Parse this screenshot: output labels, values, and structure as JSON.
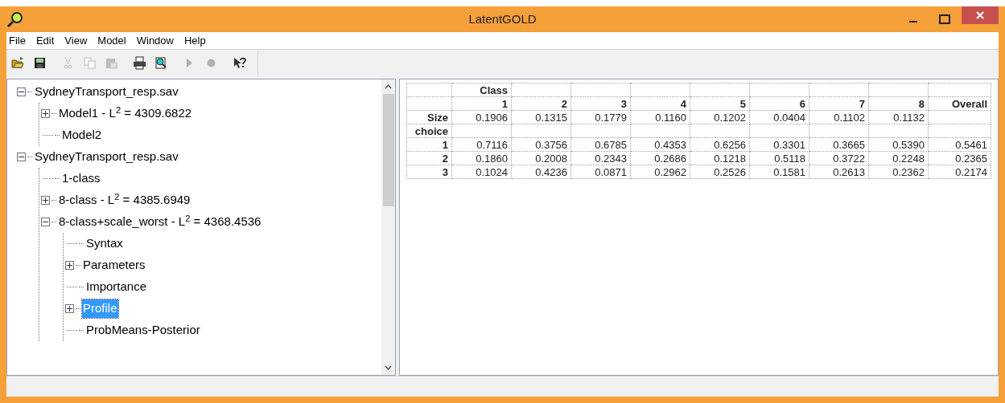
{
  "window": {
    "title": "LatentGOLD"
  },
  "menu": [
    "File",
    "Edit",
    "View",
    "Model",
    "Window",
    "Help"
  ],
  "toolbar": [
    {
      "disabled": false
    },
    {
      "disabled": false
    },
    {
      "disabled": true
    },
    {
      "disabled": true
    },
    {
      "disabled": true
    },
    {
      "disabled": false
    },
    {
      "disabled": false
    },
    {
      "disabled": true
    },
    {
      "disabled": true
    },
    {
      "disabled": false
    }
  ],
  "tree": [
    {
      "label": "SydneyTransport_resp.sav",
      "expanded": true,
      "selected": false,
      "children": [
        {
          "label": "Model1 - L$^{2}$ = 4309.6822",
          "expanded": false,
          "selected": false
        },
        {
          "label": "Model2",
          "selected": false
        }
      ]
    },
    {
      "label": "SydneyTransport_resp.sav",
      "expanded": true,
      "selected": false,
      "children": [
        {
          "label": "1-class",
          "selected": false
        },
        {
          "label": "8-class - L$^{2}$ = 4385.6949",
          "expanded": false,
          "selected": false
        },
        {
          "label": "8-class+scale_worst - L$^{2}$ = 4368.4536",
          "expanded": true,
          "selected": false,
          "children": [
            {
              "label": "Syntax",
              "selected": false
            },
            {
              "label": "Parameters",
              "expanded": false,
              "selected": false
            },
            {
              "label": "Importance",
              "selected": false
            },
            {
              "label": "Profile",
              "expanded": false,
              "selected": true
            },
            {
              "label": "ProbMeans-Posterior",
              "selected": false
            }
          ]
        }
      ]
    }
  ],
  "table": {
    "group_label": "Class",
    "columns": [
      "1",
      "2",
      "3",
      "4",
      "5",
      "6",
      "7",
      "8",
      "Overall"
    ],
    "rows": [
      {
        "kind": "data",
        "label": "Size",
        "values": [
          "0.1906",
          "0.1315",
          "0.1779",
          "0.1160",
          "0.1202",
          "0.0404",
          "0.1102",
          "0.1132"
        ]
      },
      {
        "kind": "section",
        "label": "choice"
      },
      {
        "kind": "data",
        "label": "1",
        "values": [
          "0.7116",
          "0.3756",
          "0.6785",
          "0.4353",
          "0.6256",
          "0.3301",
          "0.3665",
          "0.5390",
          "0.5461"
        ]
      },
      {
        "kind": "data",
        "label": "2",
        "values": [
          "0.1860",
          "0.2008",
          "0.2343",
          "0.2686",
          "0.1218",
          "0.5118",
          "0.3722",
          "0.2248",
          "0.2365"
        ]
      },
      {
        "kind": "data",
        "label": "3",
        "values": [
          "0.1024",
          "0.4236",
          "0.0871",
          "0.2962",
          "0.2526",
          "0.1581",
          "0.2613",
          "0.2362",
          "0.2174"
        ]
      }
    ]
  }
}
